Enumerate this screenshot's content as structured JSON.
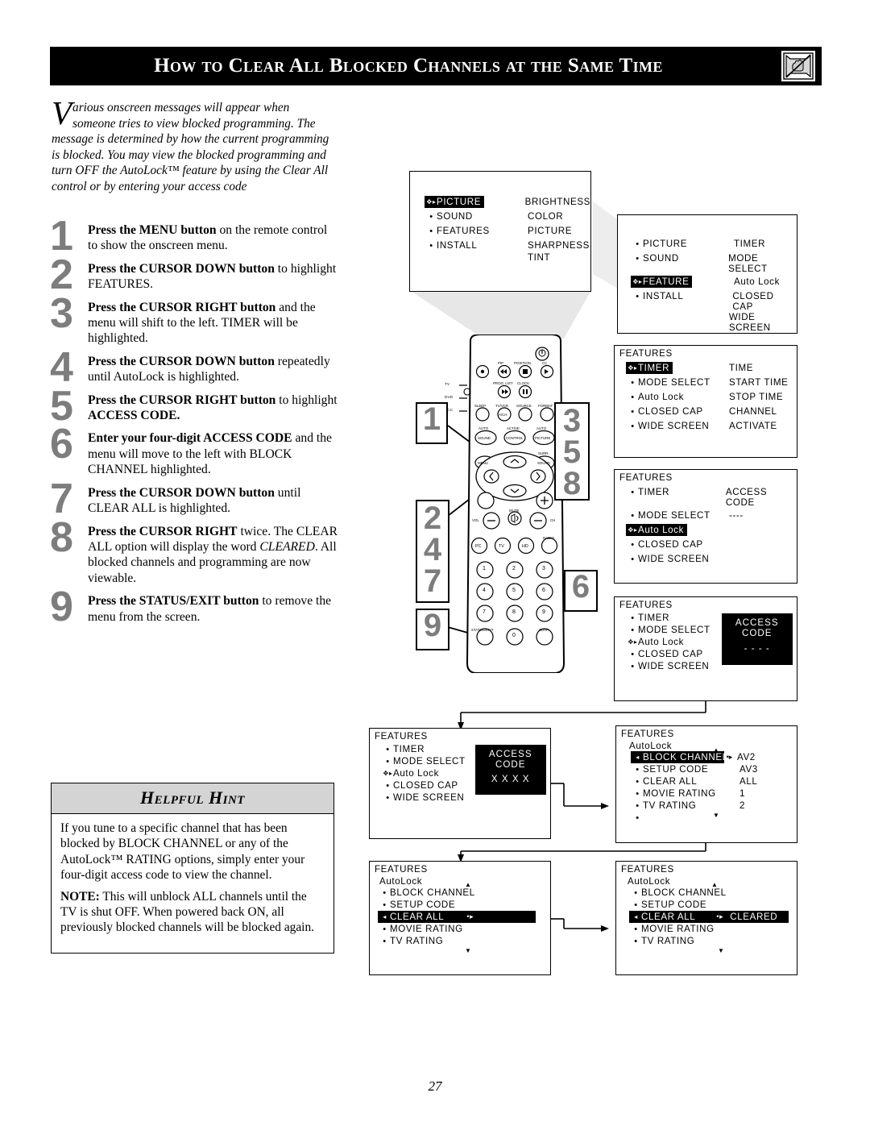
{
  "header": {
    "title": "How to Clear All Blocked Channels at the Same Time",
    "icon": "blocked-tv-hand-icon"
  },
  "intro": {
    "dropcap": "V",
    "text": "arious onscreen messages will appear when someone tries to view blocked programming. The message is determined by how the current programming is blocked. You may view the blocked programming and turn OFF the AutoLock™ feature by using the Clear All control or by entering your access code"
  },
  "steps": [
    {
      "num": "1",
      "bold": "Press the MENU button",
      "rest": " on the remote control to show the onscreen menu."
    },
    {
      "num": "2",
      "bold": "Press the CURSOR DOWN button",
      "rest": " to highlight FEATURES."
    },
    {
      "num": "3",
      "bold": "Press the CURSOR RIGHT button",
      "rest": " and the menu will shift to the left. TIMER will be highlighted."
    },
    {
      "num": "4",
      "bold": "Press the CURSOR DOWN button",
      "rest": " repeatedly until AutoLock is highlighted."
    },
    {
      "num": "5",
      "bold": "Press the CURSOR RIGHT button",
      "rest": " to highlight ",
      "bold2": "ACCESS CODE."
    },
    {
      "num": "6",
      "bold": "Enter your four-digit ACCESS CODE",
      "rest": " and the menu will move to the left with BLOCK CHANNEL highlighted."
    },
    {
      "num": "7",
      "bold": "Press the CURSOR DOWN button",
      "rest": " until CLEAR ALL is highlighted."
    },
    {
      "num": "8",
      "bold": "Press the CURSOR RIGHT",
      "rest": " twice. The CLEAR ALL option will display the word ",
      "italic": "CLEARED",
      "rest2": ". All blocked channels and programming are now viewable."
    },
    {
      "num": "9",
      "bold": "Press the STATUS/EXIT button",
      "rest": " to remove the menu from the screen."
    }
  ],
  "hint": {
    "title": "Helpful Hint",
    "para1": "If you tune to a specific channel that has been blocked by BLOCK CHANNEL or any of the AutoLock™ RATING options, simply enter your four-digit access code to view the channel.",
    "note_label": "NOTE:",
    "para2": " This will unblock ALL channels until the TV is shut OFF. When powered back ON, all previously blocked channels will be blocked again."
  },
  "page_number": "27",
  "callouts": [
    {
      "id": "c1",
      "values": [
        "1"
      ]
    },
    {
      "id": "c358",
      "values": [
        "3",
        "5",
        "8"
      ]
    },
    {
      "id": "c247",
      "values": [
        "2",
        "4",
        "7"
      ]
    },
    {
      "id": "c6",
      "values": [
        "6"
      ]
    },
    {
      "id": "c9",
      "values": [
        "9"
      ]
    }
  ],
  "screens": [
    {
      "id": "scr1",
      "title": "",
      "left_items": [
        {
          "label": "PICTURE",
          "highlight": true,
          "cursor": "updown-right"
        },
        {
          "label": "SOUND",
          "highlight": false,
          "cursor": "bullet"
        },
        {
          "label": "FEATURES",
          "highlight": false,
          "cursor": "bullet"
        },
        {
          "label": "INSTALL",
          "highlight": false,
          "cursor": "bullet"
        }
      ],
      "right_items": [
        "BRIGHTNESS",
        "COLOR",
        "PICTURE",
        "SHARPNESS",
        "TINT"
      ]
    },
    {
      "id": "scr2",
      "title": "",
      "left_items": [
        {
          "label": "PICTURE",
          "highlight": false,
          "cursor": "bullet"
        },
        {
          "label": "SOUND",
          "highlight": false,
          "cursor": "bullet"
        },
        {
          "label": "FEATURE",
          "highlight": true,
          "cursor": "updown-right"
        },
        {
          "label": "INSTALL",
          "highlight": false,
          "cursor": "bullet"
        }
      ],
      "right_items": [
        "TIMER",
        "MODE SELECT",
        "Auto Lock",
        "CLOSED CAP",
        "WIDE SCREEN"
      ]
    },
    {
      "id": "scr3",
      "title": "FEATURES",
      "left_items": [
        {
          "label": "TIMER",
          "highlight": true,
          "cursor": "updown-right"
        },
        {
          "label": "MODE SELECT",
          "highlight": false,
          "cursor": "bullet"
        },
        {
          "label": "Auto Lock",
          "highlight": false,
          "cursor": "bullet"
        },
        {
          "label": "CLOSED CAP",
          "highlight": false,
          "cursor": "bullet"
        },
        {
          "label": "WIDE SCREEN",
          "highlight": false,
          "cursor": "bullet"
        }
      ],
      "right_items": [
        "TIME",
        "START TIME",
        "STOP TIME",
        "CHANNEL",
        "ACTIVATE"
      ]
    },
    {
      "id": "scr4",
      "title": "FEATURES",
      "left_items": [
        {
          "label": "TIMER",
          "highlight": false,
          "cursor": "bullet"
        },
        {
          "label": "MODE SELECT",
          "highlight": false,
          "cursor": "bullet"
        },
        {
          "label": "Auto Lock",
          "highlight": true,
          "cursor": "updown-right"
        },
        {
          "label": "CLOSED CAP",
          "highlight": false,
          "cursor": "bullet"
        },
        {
          "label": "WIDE SCREEN",
          "highlight": false,
          "cursor": "bullet"
        }
      ],
      "right_items": [
        "ACCESS CODE",
        "----"
      ]
    },
    {
      "id": "scr5",
      "title": "FEATURES",
      "left_items": [
        {
          "label": "TIMER",
          "highlight": false,
          "cursor": "bullet"
        },
        {
          "label": "MODE SELECT",
          "highlight": false,
          "cursor": "bullet"
        },
        {
          "label": "Auto Lock",
          "highlight": false,
          "cursor": "updown-right"
        },
        {
          "label": "CLOSED CAP",
          "highlight": false,
          "cursor": "bullet"
        },
        {
          "label": "WIDE SCREEN",
          "highlight": false,
          "cursor": "bullet"
        }
      ],
      "panel": {
        "title": "ACCESS CODE",
        "value": "- - - -"
      }
    },
    {
      "id": "scr6",
      "title": "FEATURES",
      "left_items": [
        {
          "label": "TIMER",
          "highlight": false,
          "cursor": "bullet"
        },
        {
          "label": "MODE SELECT",
          "highlight": false,
          "cursor": "bullet"
        },
        {
          "label": "Auto Lock",
          "highlight": false,
          "cursor": "updown-right"
        },
        {
          "label": "CLOSED CAP",
          "highlight": false,
          "cursor": "bullet"
        },
        {
          "label": "WIDE SCREEN",
          "highlight": false,
          "cursor": "bullet"
        }
      ],
      "panel": {
        "title": "ACCESS CODE",
        "value": "X X X X"
      }
    },
    {
      "id": "scr7",
      "title": "FEATURES",
      "subtitle": "AutoLock",
      "left_items": [
        {
          "label": "BLOCK CHANNEL",
          "highlight": true,
          "cursor": "left-arrow",
          "value": "AV2"
        },
        {
          "label": "SETUP CODE",
          "highlight": false,
          "cursor": "bullet",
          "value": "AV3"
        },
        {
          "label": "CLEAR ALL",
          "highlight": false,
          "cursor": "bullet",
          "value": "ALL"
        },
        {
          "label": "MOVIE RATING",
          "highlight": false,
          "cursor": "bullet",
          "value": "1"
        },
        {
          "label": "TV RATING",
          "highlight": false,
          "cursor": "bullet",
          "value": "2"
        },
        {
          "label": "",
          "highlight": false,
          "cursor": "bullet",
          "value": ""
        }
      ],
      "scroll_up": "▲",
      "scroll_down": "▼"
    },
    {
      "id": "scr8",
      "title": "FEATURES",
      "subtitle": "AutoLock",
      "left_items": [
        {
          "label": "BLOCK CHANNEL",
          "highlight": false,
          "cursor": "bullet",
          "value": ""
        },
        {
          "label": "SETUP CODE",
          "highlight": false,
          "cursor": "bullet",
          "value": ""
        },
        {
          "label": "CLEAR ALL",
          "highlight": true,
          "cursor": "left-arrow",
          "value": ""
        },
        {
          "label": "MOVIE RATING",
          "highlight": false,
          "cursor": "bullet",
          "value": ""
        },
        {
          "label": "TV RATING",
          "highlight": false,
          "cursor": "bullet",
          "value": ""
        }
      ],
      "scroll_up": "▲",
      "scroll_down": "▼"
    },
    {
      "id": "scr9",
      "title": "FEATURES",
      "subtitle": "AutoLock",
      "left_items": [
        {
          "label": "BLOCK CHANNEL",
          "highlight": false,
          "cursor": "bullet",
          "value": ""
        },
        {
          "label": "SETUP CODE",
          "highlight": false,
          "cursor": "bullet",
          "value": ""
        },
        {
          "label": "CLEAR ALL",
          "highlight": true,
          "cursor": "left-arrow",
          "value": "CLEARED"
        },
        {
          "label": "MOVIE RATING",
          "highlight": false,
          "cursor": "bullet",
          "value": ""
        },
        {
          "label": "TV RATING",
          "highlight": false,
          "cursor": "bullet",
          "value": ""
        }
      ],
      "scroll_up": "▲",
      "scroll_down": "▼"
    }
  ],
  "remote": {
    "side_labels": [
      "TV",
      "DVD",
      "ACC"
    ],
    "top_labels": [
      "PIP",
      "POSITION",
      "CC",
      "PROG. LIST",
      "CLOCK"
    ],
    "row_labels": [
      "SLEEP",
      "TV/VCR",
      "SOURCE",
      "FORMAT"
    ],
    "ach_label": "A/CH",
    "feature_labels": [
      {
        "top": "AUTO",
        "bottom": "SOUND"
      },
      {
        "top": "ACTIVE",
        "bottom": "CONTROL"
      },
      {
        "top": "AUTO",
        "bottom": "PICTURE"
      }
    ],
    "menu_label": "MENU",
    "sound_label": "SOUND",
    "surr_label": "SURR.",
    "vol_label": "VOL",
    "ch_label": "CH",
    "mute_label": "MUTE",
    "source_buttons": [
      "PC",
      "TV",
      "HD",
      "RADIO"
    ],
    "radio_btn_label": "RADIO",
    "keypad": [
      "1",
      "2",
      "3",
      "4",
      "5",
      "6",
      "7",
      "8",
      "9",
      "0"
    ],
    "status_label": "STATUS/EXIT",
    "surf_label": "SURF"
  }
}
